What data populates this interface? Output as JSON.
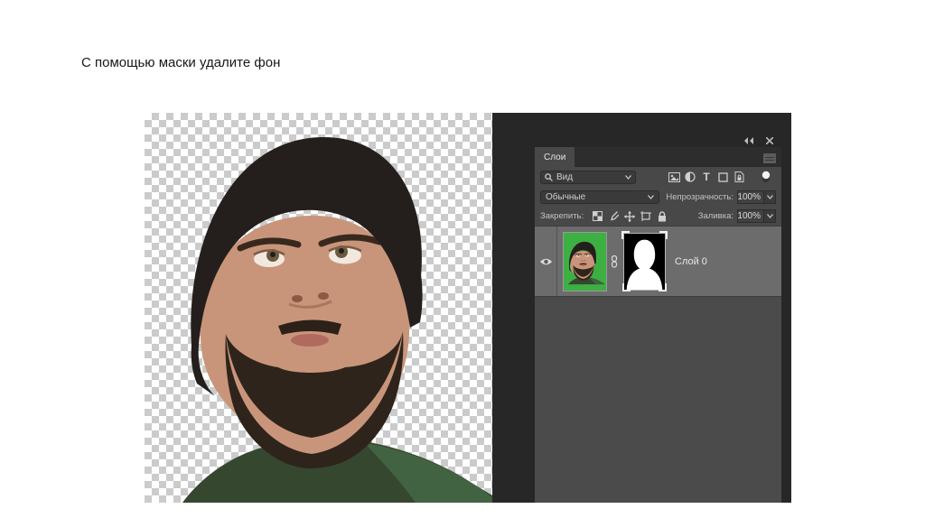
{
  "slide": {
    "title": "С помощью маски удалите фон"
  },
  "layers_panel": {
    "tab_label": "Слои",
    "filter_row": {
      "search_label": "Вид",
      "type_filter_letter": "T"
    },
    "blend_row": {
      "mode_value": "Обычные",
      "opacity_label": "Непрозрачность:",
      "opacity_value": "100%"
    },
    "lock_row": {
      "lock_label": "Закрепить:",
      "fill_label": "Заливка:",
      "fill_value": "100%"
    },
    "layer": {
      "name": "Слой 0"
    }
  },
  "icons": {
    "collapse": "double-left-triangles",
    "close": "x-cross",
    "panel_menu": "hamburger-square",
    "search": "magnifier",
    "chevron": "down-chevron",
    "filter_pixel": "image-frame",
    "filter_adjustment": "half-filled-circle",
    "filter_type": "letter-T",
    "filter_shape": "square-outline",
    "filter_smart": "page-with-lock",
    "filter_toggle": "white-circle-switch",
    "lock_transparency": "checkerboard",
    "lock_pixels": "brush",
    "lock_position": "move-cross",
    "lock_artboard": "crop-frame",
    "lock_all": "padlock",
    "visibility": "eye",
    "mask_link": "chain-link"
  },
  "colors": {
    "page_bg": "#ffffff",
    "chrome_bg": "#272727",
    "panel_bg": "#484848",
    "tabbar_bg": "#2d2d2d",
    "control_bg": "#3a3a3a",
    "selected_row_bg": "#6c6c6c",
    "green_screen": "#3cb043",
    "checker_gray": "#cbcbcb",
    "mask_black": "#000000",
    "mask_white": "#ffffff"
  }
}
